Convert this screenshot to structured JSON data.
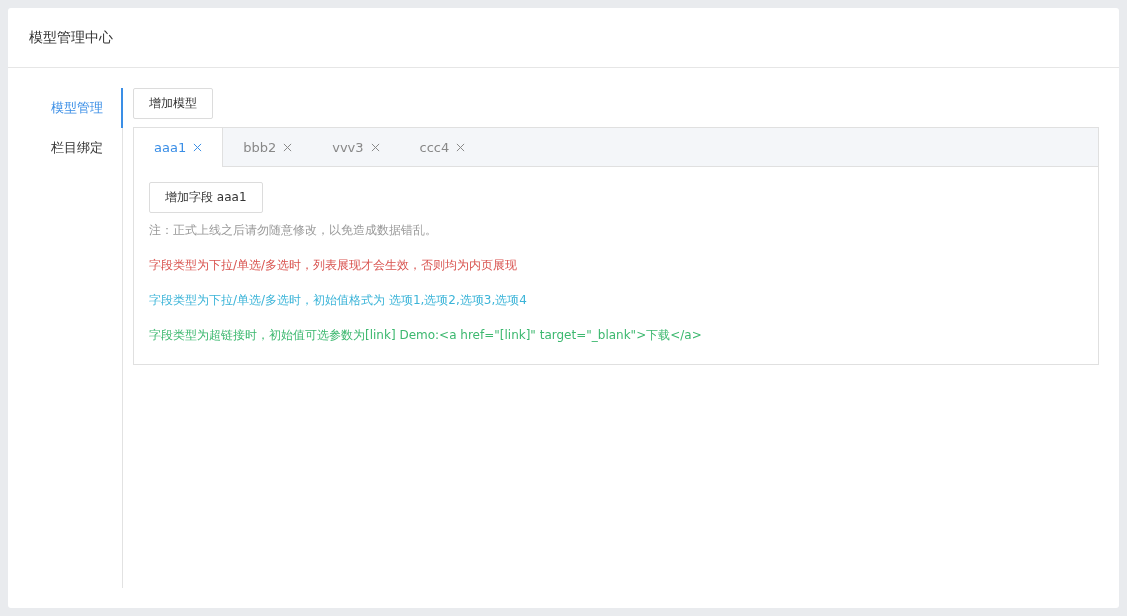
{
  "card": {
    "title": "模型管理中心"
  },
  "sidebar": {
    "items": [
      {
        "label": "模型管理",
        "selected": true
      },
      {
        "label": "栏目绑定",
        "selected": false
      }
    ]
  },
  "add_model_button": "增加模型",
  "tabs": [
    {
      "label": "aaa1",
      "selected": true
    },
    {
      "label": "bbb2",
      "selected": false
    },
    {
      "label": "vvv3",
      "selected": false
    },
    {
      "label": "ccc4",
      "selected": false
    }
  ],
  "add_field_button": "增加字段 aaa1",
  "notes": [
    {
      "text": "注：正式上线之后请勿随意修改，以免造成数据错乱。",
      "color": "#999999"
    },
    {
      "text": "字段类型为下拉/单选/多选时，列表展现才会生效，否则均为内页展现",
      "color": "#d9534f"
    },
    {
      "text": "字段类型为下拉/单选/多选时，初始值格式为 选项1,选项2,选项3,选项4",
      "color": "#3bb4d8"
    },
    {
      "text": "字段类型为超链接时，初始值可选参数为[link] Demo:<a href=\"[link]\" target=\"_blank\">下载</a>",
      "color": "#3cb86f"
    }
  ]
}
